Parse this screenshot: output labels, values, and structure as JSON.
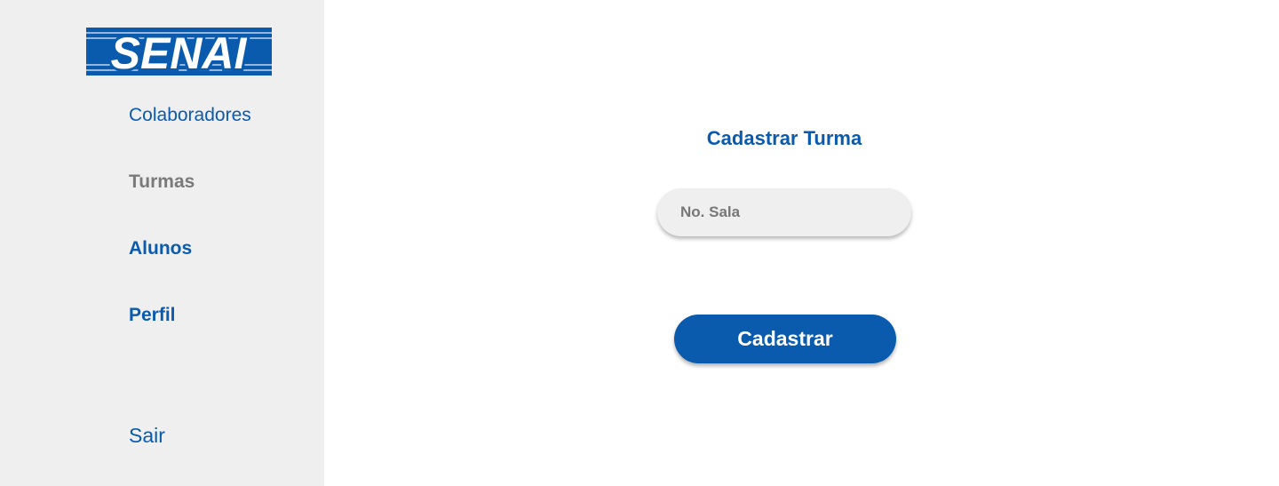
{
  "sidebar": {
    "logo_text": "SENAI",
    "items": [
      {
        "label": "Colaboradores"
      },
      {
        "label": "Turmas"
      },
      {
        "label": "Alunos"
      },
      {
        "label": "Perfil"
      }
    ],
    "logout_label": "Sair"
  },
  "main": {
    "title": "Cadastrar Turma",
    "room_input": {
      "placeholder": "No. Sala",
      "value": ""
    },
    "submit_label": "Cadastrar"
  },
  "colors": {
    "brand_blue": "#0a5bad",
    "sidebar_bg": "#efefef",
    "inactive_nav": "#7a7a7a"
  }
}
